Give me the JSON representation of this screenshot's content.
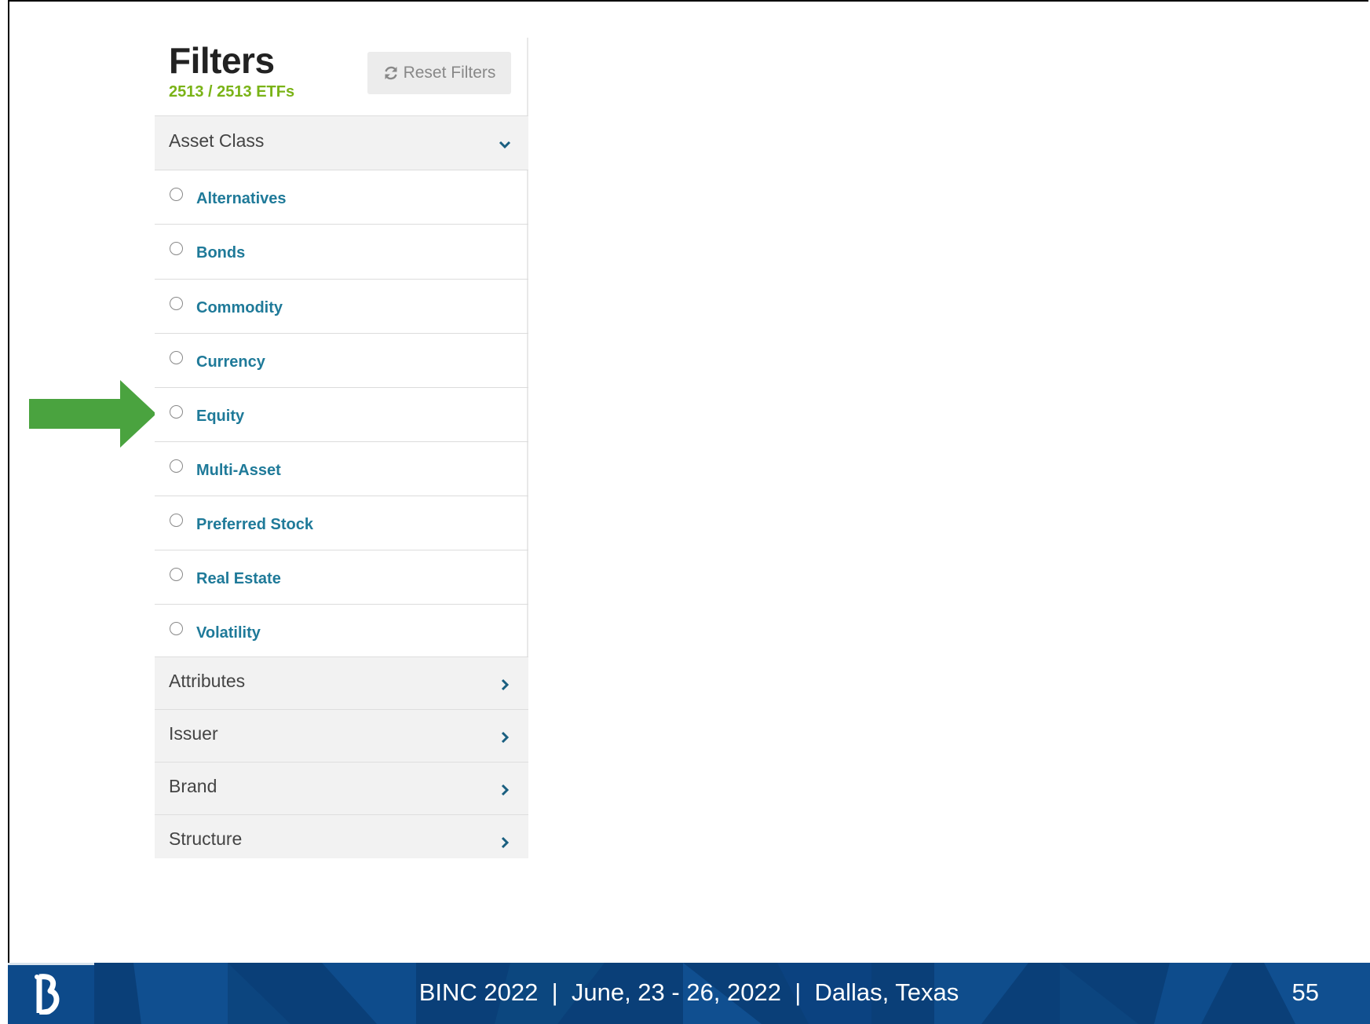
{
  "filters": {
    "title": "Filters",
    "count": "2513 / 2513 ETFs",
    "reset_label": "Reset Filters"
  },
  "asset_class": {
    "label": "Asset Class",
    "options": [
      "Alternatives",
      "Bonds",
      "Commodity",
      "Currency",
      "Equity",
      "Multi-Asset",
      "Preferred Stock",
      "Real Estate",
      "Volatility"
    ]
  },
  "collapsed_sections": [
    "Attributes",
    "Issuer",
    "Brand",
    "Structure"
  ],
  "footer": {
    "text": "BINC 2022  |  June, 23 - 26, 2022  |  Dallas, Texas",
    "page_number": "55"
  },
  "colors": {
    "accent_link": "#1f7a99",
    "count_green": "#7ab317",
    "arrow_green": "#4aa33f",
    "footer_blue": "#0a3f78"
  }
}
